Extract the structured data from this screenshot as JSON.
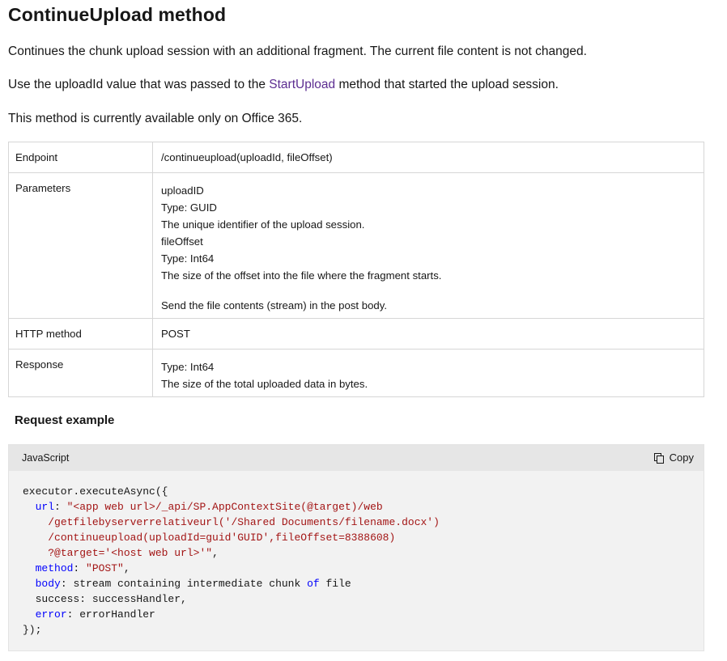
{
  "heading": "ContinueUpload method",
  "intro": {
    "p1": "Continues the chunk upload session with an additional fragment. The current file content is not changed.",
    "p2_before": "Use the uploadId value that was passed to the ",
    "p2_link": "StartUpload",
    "p2_after": " method that started the upload session.",
    "p3": "This method is currently available only on Office 365."
  },
  "table": {
    "endpoint": {
      "key": "Endpoint",
      "value": "/continueupload(uploadId, fileOffset)"
    },
    "parameters": {
      "key": "Parameters",
      "lines": [
        "uploadID",
        "Type: GUID",
        "The unique identifier of the upload session.",
        "fileOffset",
        "Type: Int64",
        "The size of the offset into the file where the fragment starts."
      ],
      "note": "Send the file contents (stream) in the post body."
    },
    "http_method": {
      "key": "HTTP method",
      "value": "POST"
    },
    "response": {
      "key": "Response",
      "lines": [
        "Type: Int64",
        "The size of the total uploaded data in bytes."
      ]
    }
  },
  "request_example": {
    "heading": "Request example",
    "language": "JavaScript",
    "copy_label": "Copy",
    "code": {
      "l1": "executor.executeAsync({",
      "url_key": "url",
      "url_1": "\"<app web url>/_api/SP.AppContextSite(@target)/web",
      "url_2": "/getfilebyserverrelativeurl('/Shared Documents/filename.docx')",
      "url_3": "/continueupload(uploadId=guid'GUID',fileOffset=8388608)",
      "url_4": "?@target='<host web url>'\"",
      "method_key": "method",
      "method_val": "\"POST\"",
      "body_key": "body",
      "body_val_1": "stream containing intermediate chunk ",
      "body_of": "of",
      "body_val_2": " file",
      "success_line": "success: successHandler,",
      "error_key": "error",
      "error_val": "errorHandler",
      "last": "});"
    }
  },
  "colors": {
    "link": "#5c2d91",
    "keyword": "#0101fd",
    "string": "#a31515",
    "code_bg": "#f2f2f2",
    "code_header_bg": "#e6e6e6"
  }
}
